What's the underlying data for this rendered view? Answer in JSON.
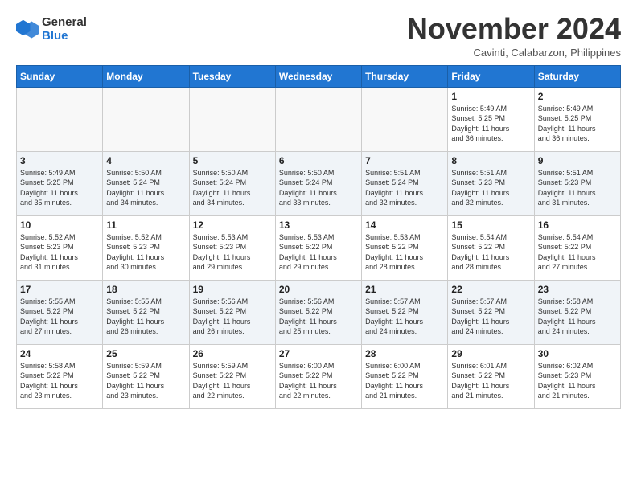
{
  "header": {
    "logo_line1": "General",
    "logo_line2": "Blue",
    "month": "November 2024",
    "location": "Cavinti, Calabarzon, Philippines"
  },
  "weekdays": [
    "Sunday",
    "Monday",
    "Tuesday",
    "Wednesday",
    "Thursday",
    "Friday",
    "Saturday"
  ],
  "rows": [
    [
      {
        "day": "",
        "info": ""
      },
      {
        "day": "",
        "info": ""
      },
      {
        "day": "",
        "info": ""
      },
      {
        "day": "",
        "info": ""
      },
      {
        "day": "",
        "info": ""
      },
      {
        "day": "1",
        "info": "Sunrise: 5:49 AM\nSunset: 5:25 PM\nDaylight: 11 hours\nand 36 minutes."
      },
      {
        "day": "2",
        "info": "Sunrise: 5:49 AM\nSunset: 5:25 PM\nDaylight: 11 hours\nand 36 minutes."
      }
    ],
    [
      {
        "day": "3",
        "info": "Sunrise: 5:49 AM\nSunset: 5:25 PM\nDaylight: 11 hours\nand 35 minutes."
      },
      {
        "day": "4",
        "info": "Sunrise: 5:50 AM\nSunset: 5:24 PM\nDaylight: 11 hours\nand 34 minutes."
      },
      {
        "day": "5",
        "info": "Sunrise: 5:50 AM\nSunset: 5:24 PM\nDaylight: 11 hours\nand 34 minutes."
      },
      {
        "day": "6",
        "info": "Sunrise: 5:50 AM\nSunset: 5:24 PM\nDaylight: 11 hours\nand 33 minutes."
      },
      {
        "day": "7",
        "info": "Sunrise: 5:51 AM\nSunset: 5:24 PM\nDaylight: 11 hours\nand 32 minutes."
      },
      {
        "day": "8",
        "info": "Sunrise: 5:51 AM\nSunset: 5:23 PM\nDaylight: 11 hours\nand 32 minutes."
      },
      {
        "day": "9",
        "info": "Sunrise: 5:51 AM\nSunset: 5:23 PM\nDaylight: 11 hours\nand 31 minutes."
      }
    ],
    [
      {
        "day": "10",
        "info": "Sunrise: 5:52 AM\nSunset: 5:23 PM\nDaylight: 11 hours\nand 31 minutes."
      },
      {
        "day": "11",
        "info": "Sunrise: 5:52 AM\nSunset: 5:23 PM\nDaylight: 11 hours\nand 30 minutes."
      },
      {
        "day": "12",
        "info": "Sunrise: 5:53 AM\nSunset: 5:23 PM\nDaylight: 11 hours\nand 29 minutes."
      },
      {
        "day": "13",
        "info": "Sunrise: 5:53 AM\nSunset: 5:22 PM\nDaylight: 11 hours\nand 29 minutes."
      },
      {
        "day": "14",
        "info": "Sunrise: 5:53 AM\nSunset: 5:22 PM\nDaylight: 11 hours\nand 28 minutes."
      },
      {
        "day": "15",
        "info": "Sunrise: 5:54 AM\nSunset: 5:22 PM\nDaylight: 11 hours\nand 28 minutes."
      },
      {
        "day": "16",
        "info": "Sunrise: 5:54 AM\nSunset: 5:22 PM\nDaylight: 11 hours\nand 27 minutes."
      }
    ],
    [
      {
        "day": "17",
        "info": "Sunrise: 5:55 AM\nSunset: 5:22 PM\nDaylight: 11 hours\nand 27 minutes."
      },
      {
        "day": "18",
        "info": "Sunrise: 5:55 AM\nSunset: 5:22 PM\nDaylight: 11 hours\nand 26 minutes."
      },
      {
        "day": "19",
        "info": "Sunrise: 5:56 AM\nSunset: 5:22 PM\nDaylight: 11 hours\nand 26 minutes."
      },
      {
        "day": "20",
        "info": "Sunrise: 5:56 AM\nSunset: 5:22 PM\nDaylight: 11 hours\nand 25 minutes."
      },
      {
        "day": "21",
        "info": "Sunrise: 5:57 AM\nSunset: 5:22 PM\nDaylight: 11 hours\nand 24 minutes."
      },
      {
        "day": "22",
        "info": "Sunrise: 5:57 AM\nSunset: 5:22 PM\nDaylight: 11 hours\nand 24 minutes."
      },
      {
        "day": "23",
        "info": "Sunrise: 5:58 AM\nSunset: 5:22 PM\nDaylight: 11 hours\nand 24 minutes."
      }
    ],
    [
      {
        "day": "24",
        "info": "Sunrise: 5:58 AM\nSunset: 5:22 PM\nDaylight: 11 hours\nand 23 minutes."
      },
      {
        "day": "25",
        "info": "Sunrise: 5:59 AM\nSunset: 5:22 PM\nDaylight: 11 hours\nand 23 minutes."
      },
      {
        "day": "26",
        "info": "Sunrise: 5:59 AM\nSunset: 5:22 PM\nDaylight: 11 hours\nand 22 minutes."
      },
      {
        "day": "27",
        "info": "Sunrise: 6:00 AM\nSunset: 5:22 PM\nDaylight: 11 hours\nand 22 minutes."
      },
      {
        "day": "28",
        "info": "Sunrise: 6:00 AM\nSunset: 5:22 PM\nDaylight: 11 hours\nand 21 minutes."
      },
      {
        "day": "29",
        "info": "Sunrise: 6:01 AM\nSunset: 5:22 PM\nDaylight: 11 hours\nand 21 minutes."
      },
      {
        "day": "30",
        "info": "Sunrise: 6:02 AM\nSunset: 5:23 PM\nDaylight: 11 hours\nand 21 minutes."
      }
    ]
  ]
}
